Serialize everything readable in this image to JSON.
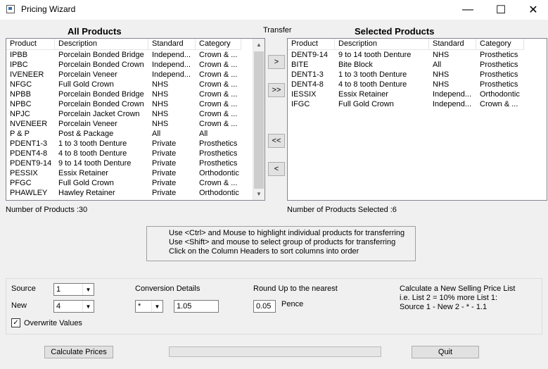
{
  "window": {
    "title": "Pricing Wizard",
    "minimize": "—",
    "maximize": "☐",
    "close": "✕"
  },
  "all_products": {
    "title": "All Products",
    "columns": [
      "Product",
      "Description",
      "Standard",
      "Category"
    ],
    "rows": [
      [
        "IPBB",
        "Porcelain Bonded Bridge",
        "Independ...",
        "Crown & ..."
      ],
      [
        "IPBC",
        "Porcelain Bonded Crown",
        "Independ...",
        "Crown & ..."
      ],
      [
        "IVENEER",
        "Porcelain Veneer",
        "Independ...",
        "Crown & ..."
      ],
      [
        "NFGC",
        "Full Gold Crown",
        "NHS",
        "Crown & ..."
      ],
      [
        "NPBB",
        "Porcelain Bonded Bridge",
        "NHS",
        "Crown & ..."
      ],
      [
        "NPBC",
        "Porcelain Bonded Crown",
        "NHS",
        "Crown & ..."
      ],
      [
        "NPJC",
        "Porcelain Jacket Crown",
        "NHS",
        "Crown & ..."
      ],
      [
        "NVENEER",
        "Porcelain Veneer",
        "NHS",
        "Crown & ..."
      ],
      [
        "P & P",
        "Post & Package",
        "All",
        "All"
      ],
      [
        "PDENT1-3",
        "1 to 3 tooth Denture",
        "Private",
        "Prosthetics"
      ],
      [
        "PDENT4-8",
        "4 to 8 tooth Denture",
        "Private",
        "Prosthetics"
      ],
      [
        "PDENT9-14",
        "9 to 14 tooth Denture",
        "Private",
        "Prosthetics"
      ],
      [
        "PESSIX",
        "Essix Retainer",
        "Private",
        "Orthodontic"
      ],
      [
        "PFGC",
        "Full Gold Crown",
        "Private",
        "Crown & ..."
      ],
      [
        "PHAWLEY",
        "Hawley Retainer",
        "Private",
        "Orthodontic"
      ]
    ],
    "count_label": "Number of Products :30"
  },
  "transfer": {
    "label": "Transfer",
    "move_one": ">",
    "move_all": ">>",
    "remove_all": "<<",
    "remove_one": "<"
  },
  "selected_products": {
    "title": "Selected Products",
    "columns": [
      "Product",
      "Description",
      "Standard",
      "Category"
    ],
    "rows": [
      [
        "DENT9-14",
        "9 to 14 tooth Denture",
        "NHS",
        "Prosthetics"
      ],
      [
        "BITE",
        "Bite Block",
        "All",
        "Prosthetics"
      ],
      [
        "DENT1-3",
        "1 to 3 tooth Denture",
        "NHS",
        "Prosthetics"
      ],
      [
        "DENT4-8",
        "4 to 8 tooth Denture",
        "NHS",
        "Prosthetics"
      ],
      [
        "IESSIX",
        "Essix Retainer",
        "Independ...",
        "Orthodontic"
      ],
      [
        "IFGC",
        "Full Gold Crown",
        "Independ...",
        "Crown & ..."
      ]
    ],
    "count_label": "Number of Products Selected :6"
  },
  "hint": {
    "line1": "Use <Ctrl> and Mouse to highlight individual products for transferring",
    "line2": "Use <Shift> and mouse to select group of products for transferring",
    "line3": "Click on the Column Headers to sort columns into order"
  },
  "settings": {
    "source_label": "Source",
    "source_value": "1",
    "new_label": "New",
    "new_value": "4",
    "overwrite_label": "Overwrite Values",
    "overwrite_checked": "✓",
    "conversion_label": "Conversion Details",
    "operator_value": "*",
    "factor_value": "1.05",
    "round_label": "Round Up to the nearest",
    "round_value": "0.05",
    "round_unit": "Pence",
    "info_line1": "Calculate a New Selling Price List",
    "info_line2": "i.e. List 2 = 10% more List 1:",
    "info_line3": "Source 1 - New 2 - * - 1.1"
  },
  "footer": {
    "calculate_label": "Calculate Prices",
    "quit_label": "Quit",
    "progress": 0
  }
}
